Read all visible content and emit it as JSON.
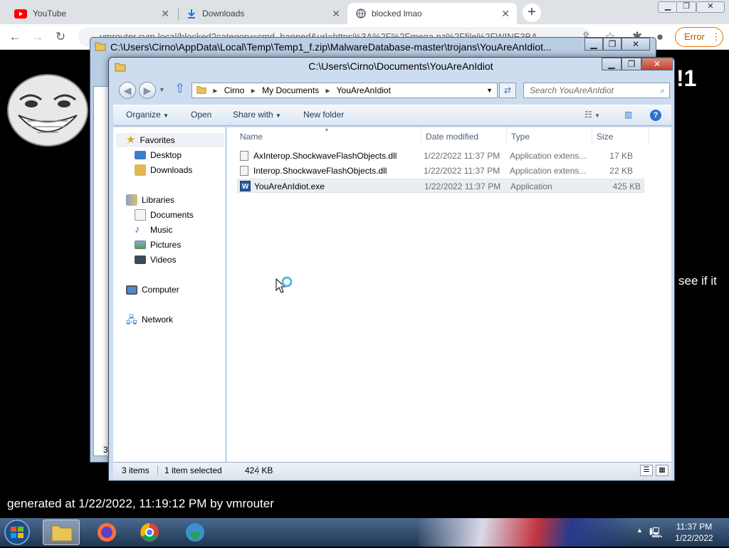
{
  "browser": {
    "tabs": [
      {
        "label": "YouTube",
        "icon": "youtube-icon",
        "active": false
      },
      {
        "label": "Downloads",
        "icon": "download-icon",
        "active": false
      },
      {
        "label": "blocked lmao",
        "icon": "globe-icon",
        "active": true
      }
    ],
    "url": "vmrouter.cvm.local/blocked?category=cmd_banned&url=https%3A%2F%2Fmega.nz%2Ffile%2FWINE3BA",
    "error_label": "Error"
  },
  "page": {
    "heading_tail": "!1",
    "body_tail": "see if it",
    "generated": "generated at 1/22/2022, 11:19:12 PM by vmrouter"
  },
  "back_window": {
    "title": "C:\\Users\\Cirno\\AppData\\Local\\Temp\\Temp1_f.zip\\MalwareDatabase-master\\trojans\\YouAreAnIdiot...",
    "status_fragment": "3"
  },
  "explorer": {
    "title": "C:\\Users\\Cirno\\Documents\\YouAreAnIdiot",
    "breadcrumb": [
      "Cirno",
      "My Documents",
      "YouAreAnIdiot"
    ],
    "search_placeholder": "Search YouAreAnIdiot",
    "commands": {
      "organize": "Organize",
      "open": "Open",
      "share": "Share with",
      "new_folder": "New folder"
    },
    "nav": {
      "favorites": "Favorites",
      "desktop": "Desktop",
      "downloads": "Downloads",
      "libraries": "Libraries",
      "documents": "Documents",
      "music": "Music",
      "pictures": "Pictures",
      "videos": "Videos",
      "computer": "Computer",
      "network": "Network"
    },
    "columns": {
      "name": "Name",
      "date": "Date modified",
      "type": "Type",
      "size": "Size"
    },
    "files": [
      {
        "name": "AxInterop.ShockwaveFlashObjects.dll",
        "date": "1/22/2022 11:37 PM",
        "type": "Application extens...",
        "size": "17 KB",
        "selected": false
      },
      {
        "name": "Interop.ShockwaveFlashObjects.dll",
        "date": "1/22/2022 11:37 PM",
        "type": "Application extens...",
        "size": "22 KB",
        "selected": false
      },
      {
        "name": "YouAreAnIdiot.exe",
        "date": "1/22/2022 11:37 PM",
        "type": "Application",
        "size": "425 KB",
        "selected": true
      }
    ],
    "status": {
      "count": "3 items",
      "selection": "1 item selected",
      "sel_size": "424 KB"
    }
  },
  "taskbar": {
    "time": "11:37 PM",
    "date": "1/22/2022"
  },
  "colors": {
    "chrome_bg": "#dee1e6",
    "window_frame": "#cddcef",
    "taskbar": "#1e3552",
    "error": "#b06000"
  }
}
